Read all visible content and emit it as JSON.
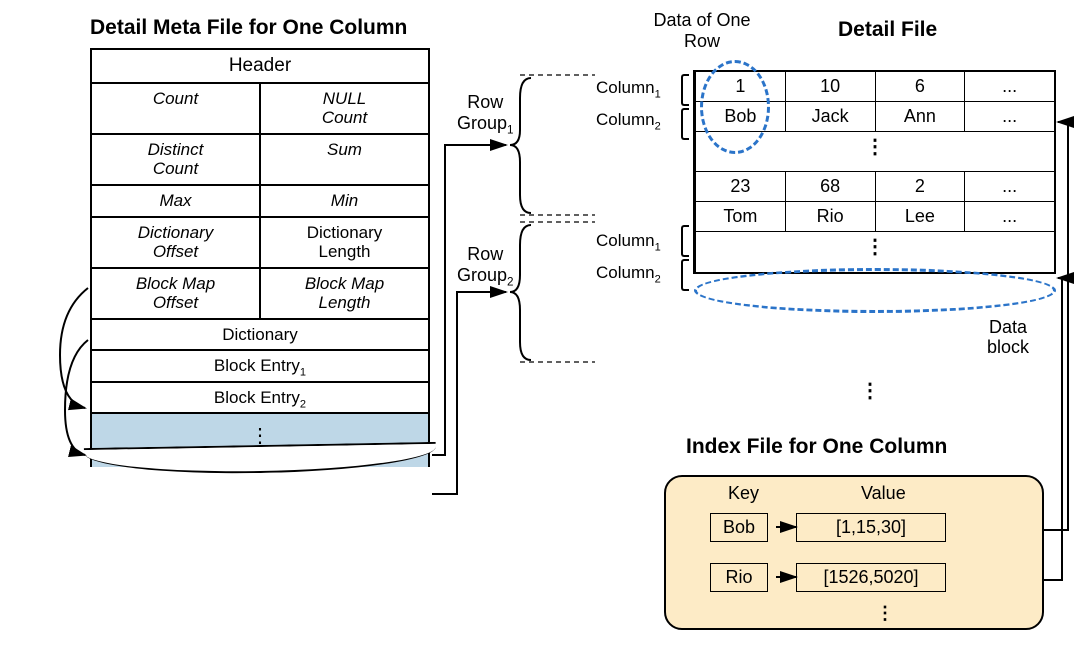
{
  "titles": {
    "meta": "Detail Meta File for One Column",
    "detail": "Detail File",
    "index": "Index File for One Column",
    "dataOfRow": "Data of One\nRow"
  },
  "meta": {
    "header": "Header",
    "count": "Count",
    "nullCount": "NULL\nCount",
    "distinct": "Distinct\nCount",
    "sum": "Sum",
    "max": "Max",
    "min": "Min",
    "dictOff": "Dictionary\nOffset",
    "dictLen": "Dictionary\nLength",
    "bmOff": "Block Map\nOffset",
    "bmLen": "Block Map\nLength",
    "dict": "Dictionary",
    "be1": "Block Entry",
    "be2": "Block Entry",
    "dots": "⋮"
  },
  "labels": {
    "rg1": "Row\nGroup",
    "rg2": "Row\nGroup",
    "col1": "Column",
    "col2": "Column",
    "dataBlock": "Data\nblock",
    "key": "Key",
    "value": "Value"
  },
  "detail": {
    "r1": [
      "1",
      "10",
      "6",
      "..."
    ],
    "r2": [
      "Bob",
      "Jack",
      "Ann",
      "..."
    ],
    "r3": [
      "23",
      "68",
      "2",
      "..."
    ],
    "r4": [
      "Tom",
      "Rio",
      "Lee",
      "..."
    ],
    "gap": "⋮"
  },
  "index": {
    "k1": "Bob",
    "v1": "[1,15,30]",
    "k2": "Rio",
    "v2": "[1526,5020]",
    "dots": "⋮"
  }
}
